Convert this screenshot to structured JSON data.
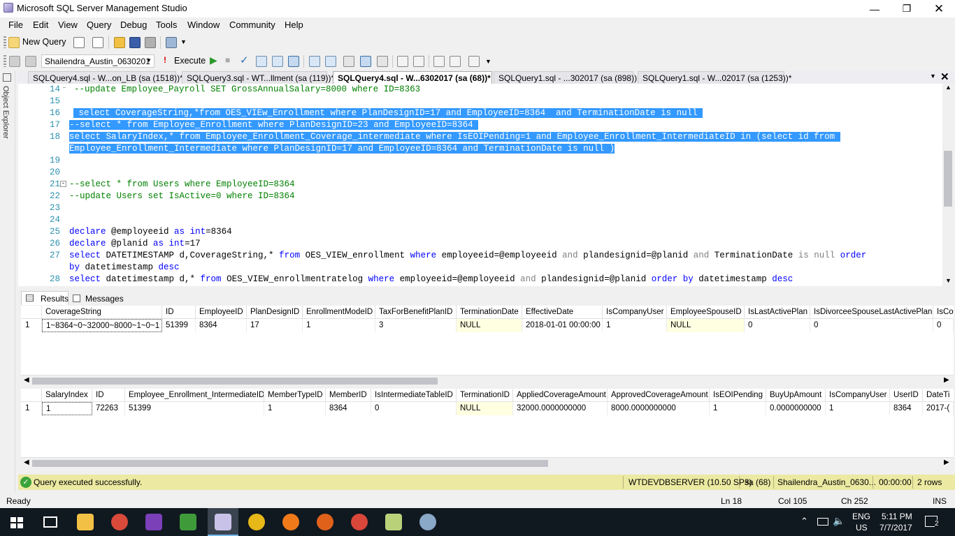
{
  "window": {
    "title": "Microsoft SQL Server Management Studio"
  },
  "menu": [
    "File",
    "Edit",
    "View",
    "Query",
    "Debug",
    "Tools",
    "Window",
    "Community",
    "Help"
  ],
  "toolbar": {
    "new_query": "New Query",
    "database": "Shailendra_Austin_0630201",
    "execute": "Execute"
  },
  "side_panel": {
    "label": "Object Explorer"
  },
  "tabs": [
    "SQLQuery4.sql - W...on_LB (sa (1518))*",
    "SQLQuery3.sql - WT...llment (sa (119))*",
    "SQLQuery4.sql - W...6302017 (sa (68))*",
    "SQLQuery1.sql - ...302017 (sa (898))",
    "SQLQuery1.sql - W...02017 (sa (1253))*"
  ],
  "editor": {
    "line_numbers": [
      "14",
      "15",
      "16",
      "17",
      "18",
      "19",
      "20",
      "21",
      "22",
      "23",
      "24",
      "25",
      "26",
      "27",
      "28"
    ],
    "lines": {
      "l14": "--update Employee_Payroll SET GrossAnnualSalary=8000 where ID=8363",
      "l16": " select CoverageString,*from OES_VIEw_Enrollment where PlanDesignID=17 and EmployeeID=8364  and TerminationDate is null ",
      "l17": "--select * from Employee_Enrollment where PlanDesignID=23 and EmployeeID=8364 ",
      "l18a": "select SalaryIndex,* from Employee_Enrollment_Coverage_intermediate where IsEOIPending=1 and Employee_Enrollment_IntermediateID in (select id from ",
      "l18b": "Employee_Enrollment_Intermediate where PlanDesignID=17 and EmployeeID=8364 and TerminationDate is null )",
      "l21": "--select * from Users where EmployeeID=8364",
      "l22": "--update Users set IsActive=0 where ID=8364",
      "l25_kw": "declare",
      "l25_var": " @employeeid ",
      "l25_as": "as",
      "l25_type": " int",
      "l25_val": "=8364",
      "l26_kw": "declare",
      "l26_var": " @planid ",
      "l26_as": "as",
      "l26_type": " int",
      "l26_val": "=17",
      "l27_select": "select",
      "l27_a": " DATETIMESTAMP d,CoverageString,* ",
      "l27_from": "from",
      "l27_b": " OES_VIEW_enrollment ",
      "l27_where": "where",
      "l27_c": " employeeid=@employeeid ",
      "l27_and": "and",
      "l27_d": " plandesignid=@planid ",
      "l27_and2": "and",
      "l27_e": " TerminationDate ",
      "l27_isnull": "is null",
      "l27_f": " ",
      "l27_order": "order",
      "l27b_by": "by",
      "l27b_rest": " datetimestamp ",
      "l27b_desc": "desc",
      "l28_select": "select",
      "l28_a": " datetimestamp d,* ",
      "l28_from": "from",
      "l28_b": " OES_VIEW_enrollmentratelog ",
      "l28_where": "where",
      "l28_c": " employeeid=@employeeid ",
      "l28_and": "and",
      "l28_d": " plandesignid=@planid ",
      "l28_order": "order by",
      "l28_e": " datetimestamp ",
      "l28_desc": "desc"
    }
  },
  "results_tabs": {
    "results": "Results",
    "messages": "Messages"
  },
  "grid1": {
    "headers": [
      "CoverageString",
      "ID",
      "EmployeeID",
      "PlanDesignID",
      "EnrollmentModeID",
      "TaxForBenefitPlanID",
      "TerminationDate",
      "EffectiveDate",
      "IsCompanyUser",
      "EmployeeSpouseID",
      "IsLastActivePlan",
      "IsDivorceeSpouseLastActivePlan",
      "IsCo"
    ],
    "row_num": "1",
    "row": [
      "1~8364~0~32000~8000~1~0~1",
      "51399",
      "8364",
      "17",
      "1",
      "3",
      "NULL",
      "2018-01-01 00:00:00",
      "1",
      "NULL",
      "0",
      "0",
      "0"
    ]
  },
  "grid2": {
    "headers": [
      "SalaryIndex",
      "ID",
      "Employee_Enrollment_IntermediateID",
      "MemberTypeID",
      "MemberID",
      "IsIntermediateTableID",
      "TerminationID",
      "AppliedCoverageAmount",
      "ApprovedCoverageAmount",
      "IsEOIPending",
      "BuyUpAmount",
      "IsCompanyUser",
      "UserID",
      "DateTi"
    ],
    "row_num": "1",
    "row": [
      "1",
      "72263",
      "51399",
      "1",
      "8364",
      "0",
      "NULL",
      "32000.0000000000",
      "8000.0000000000",
      "1",
      "0.0000000000",
      "1",
      "8364",
      "2017-("
    ]
  },
  "query_status": {
    "message": "Query executed successfully.",
    "server": "WTDEVDBSERVER (10.50 SP3)",
    "user": "sa (68)",
    "database": "Shailendra_Austin_0630...",
    "time": "00:00:00",
    "rows": "2 rows"
  },
  "statusbar": {
    "ready": "Ready",
    "line": "Ln 18",
    "col": "Col 105",
    "ch": "Ch 252",
    "ins": "INS"
  },
  "taskbar": {
    "lang1": "ENG",
    "lang2": "US",
    "time": "5:11 PM",
    "date": "7/7/2017",
    "notifications": "2"
  }
}
